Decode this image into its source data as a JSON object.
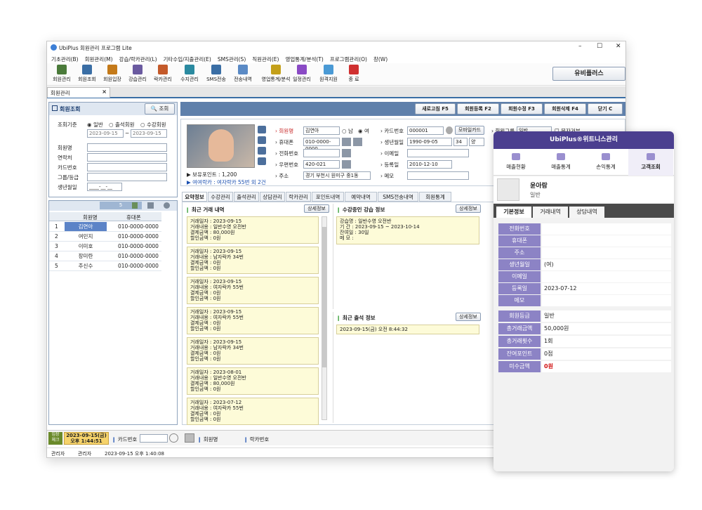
{
  "app": {
    "title": "UbiPlus 회원관리 프로그램 Lite",
    "window_controls": [
      "–",
      "☐",
      "✕"
    ],
    "menu": [
      "기초관리(B)",
      "회원관리(M)",
      "강습/락카관리(L)",
      "기타수입/지출관리(E)",
      "SMS관리(S)",
      "직원관리(E)",
      "영업통계/분석(T)",
      "프로그램관리(O)",
      "창(W)"
    ],
    "toolbar": [
      "회원관리",
      "회원조회",
      "회원입장",
      "강습관리",
      "락카관리",
      "수지관리",
      "SMS전송",
      "전송내역",
      "영업통계/분석",
      "일정관리",
      "원격지원",
      "종 료"
    ],
    "brand_button": "유비플러스",
    "doc_tab": "회원관리"
  },
  "search": {
    "title": "회원조회",
    "search_button": "조회",
    "criteria_label": "조회기준",
    "radios": [
      "일반",
      "출석회원",
      "수강회원"
    ],
    "date_from": "2023-09-15",
    "date_to": "2023-09-15",
    "tilde": "~",
    "fields": [
      "회원명",
      "연락처",
      "카드번호",
      "그룹/등급",
      "생년월일"
    ],
    "birth_value": "____-__-__",
    "count": "5",
    "columns": [
      "회원명",
      "휴대폰"
    ],
    "rows": [
      {
        "no": "1",
        "name": "김연아",
        "phone": "010-0000-0000"
      },
      {
        "no": "2",
        "name": "여민지",
        "phone": "010-0000-0000"
      },
      {
        "no": "3",
        "name": "이미호",
        "phone": "010-0000-0000"
      },
      {
        "no": "4",
        "name": "장미란",
        "phone": "010-0000-0000"
      },
      {
        "no": "5",
        "name": "추신수",
        "phone": "010-0000-0000"
      }
    ]
  },
  "actions": [
    "새로고침 F5",
    "회원등록 F2",
    "회원수정 F3",
    "회원삭제 F4",
    "닫기 C"
  ],
  "member": {
    "labels": {
      "name": "회원명",
      "phone": "휴대폰",
      "tel": "전화번호",
      "zip": "우편번호",
      "addr": "주소",
      "card": "카드번호",
      "birth": "생년월일",
      "email": "이메일",
      "reg": "등록일",
      "memo": "메모",
      "group": "회원그룹"
    },
    "name": "김연아",
    "gender_m": "남",
    "gender_f": "여",
    "phone": "010-0000-0000",
    "zip": "420-021",
    "addr": "경기 부천시 원미구 중1동",
    "card": "000001",
    "mobile_card": "모바일카드",
    "birth": "1990-09-05",
    "age": "34",
    "lunar": "양",
    "reg": "2010-12-10",
    "group": "일반",
    "sms_refuse": "문자거부",
    "points": "▶ 보유포인트 : 1,200",
    "locker": "▶ 여여락카 : 여자락카 55번 외 2건"
  },
  "tabs": [
    "요약정보",
    "수강관리",
    "출석관리",
    "상담관리",
    "락카관리",
    "포인트내역",
    "예약내역",
    "SMS전송내역",
    "회원통계"
  ],
  "summary": {
    "recent_title": "최근 거래 내역",
    "detail": "상세정보",
    "transactions": [
      [
        "거래일자 : 2023-09-15",
        "거래내용 : 일반수영 오전반",
        "결제금액 : 80,000원",
        "할인금액 : 0원"
      ],
      [
        "거래일자 : 2023-09-15",
        "거래내용 : 남자락카 34번",
        "결제금액 : 0원",
        "할인금액 : 0원"
      ],
      [
        "거래일자 : 2023-09-15",
        "거래내용 : 여자락카 55번",
        "결제금액 : 0원",
        "할인금액 : 0원"
      ],
      [
        "거래일자 : 2023-09-15",
        "거래내용 : 여자락카 55번",
        "결제금액 : 0원",
        "할인금액 : 0원"
      ],
      [
        "거래일자 : 2023-09-15",
        "거래내용 : 남자락카 34번",
        "결제금액 : 0원",
        "할인금액 : 0원"
      ],
      [
        "거래일자 : 2023-08-01",
        "거래내용 : 일반수영 오전반",
        "결제금액 : 80,000원",
        "할인금액 : 0원"
      ],
      [
        "거래일자 : 2023-07-12",
        "거래내용 : 여자락카 55번",
        "결제금액 : 0원",
        "할인금액 : 0원"
      ]
    ],
    "course_title": "수강중인 강습 정보",
    "course": [
      "강습명 : 일반수영 오전반",
      "기 간 : 2023-09-15 ~ 2023-10-14",
      "잔여일 : 30일",
      "메 모 :"
    ],
    "attend_title": "최근 출석 정보",
    "attend": "2023-09-15(금) 오전 8:44:32"
  },
  "bottom": {
    "badge": "입장\n체크",
    "datetime_line1": "2023-09-15(금)",
    "datetime_line2": "오후 1:44:51",
    "card_label": "카드번호",
    "name_label": "회원명",
    "locker_label": "락카번호"
  },
  "status": [
    "관리자",
    "관리자",
    "2023-09-15 오후 1:40:08"
  ],
  "mobile": {
    "header": "UbiPlus®위트니스관리",
    "nav": [
      "매출현황",
      "매출통계",
      "손익통계",
      "고객조회"
    ],
    "name": "윤아람",
    "grade": "일반",
    "tabs": [
      "기본정보",
      "거래내역",
      "상담내역"
    ],
    "basic": [
      {
        "k": "전화번호",
        "v": ""
      },
      {
        "k": "휴대폰",
        "v": ""
      },
      {
        "k": "주소",
        "v": ""
      },
      {
        "k": "생년월일",
        "v": "(여)"
      },
      {
        "k": "이메일",
        "v": ""
      },
      {
        "k": "등록일",
        "v": "2023-07-12"
      },
      {
        "k": "메모",
        "v": ""
      }
    ],
    "stats": [
      {
        "k": "회원등급",
        "v": "일반"
      },
      {
        "k": "총거래금액",
        "v": "50,000원"
      },
      {
        "k": "총거래횟수",
        "v": "1회"
      },
      {
        "k": "잔여포인트",
        "v": "0점"
      },
      {
        "k": "미수금액",
        "v": "0원",
        "red": true
      }
    ]
  },
  "colors": {
    "accent": "#3a6ea5",
    "mobile_header": "#4b3f8f",
    "card_bg": "#fdfbd8"
  }
}
